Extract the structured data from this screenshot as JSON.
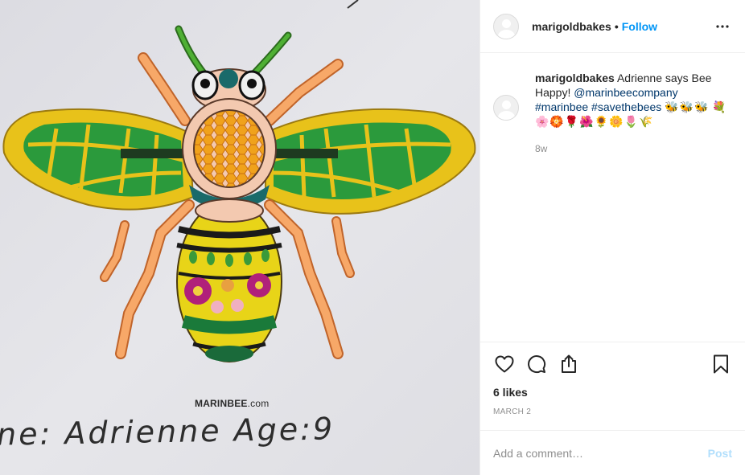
{
  "media": {
    "watermark_brand": "MARINBEE",
    "watermark_suffix": ".com",
    "handwriting": "ne: Adrienne  Age:9"
  },
  "header": {
    "username": "marigoldbakes",
    "separator": "•",
    "follow_label": "Follow",
    "more_icon": "more-horizontal-icon"
  },
  "caption": {
    "username": "marigoldbakes",
    "text_before": "Adrienne says Bee Happy!",
    "mention": "@marinbeecompany",
    "hashtag_1": "#marinbee",
    "hashtag_2": "#savethebees",
    "emoji_line_1": "🐝🐝🐝",
    "emoji_line_2": "💐🌸🏵️🌹🌺🌻🌼🌷🌾",
    "time": "8w"
  },
  "actions": {
    "like_icon": "heart-icon",
    "comment_icon": "comment-icon",
    "share_icon": "share-icon",
    "save_icon": "bookmark-icon"
  },
  "likes": "6 likes",
  "date": "MARCH 2",
  "add_comment": {
    "placeholder": "Add a comment…",
    "post_label": "Post"
  },
  "colors": {
    "link": "#0095f6",
    "tag": "#00376b",
    "post_disabled": "#b2dffc",
    "muted": "#8e8e8e"
  }
}
